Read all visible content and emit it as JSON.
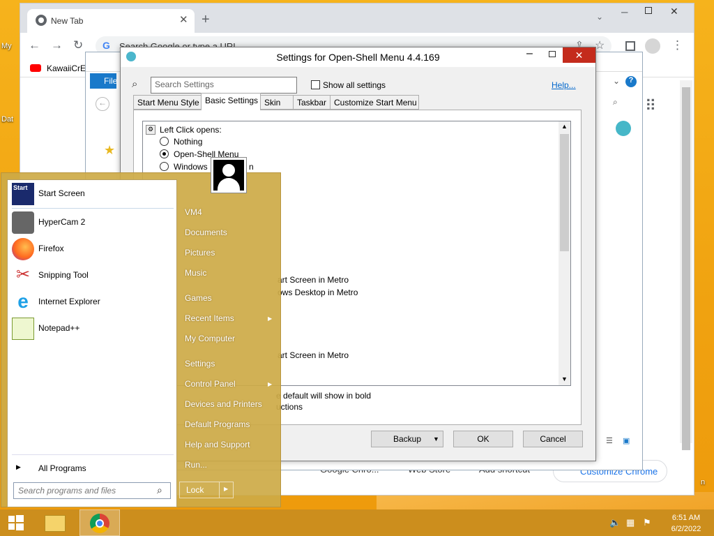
{
  "desktop": {
    "labels": [
      "My",
      "Dat",
      "n"
    ]
  },
  "chrome": {
    "tab_title": "New Tab",
    "omnibox_placeholder": "Search Google or type a URL",
    "bookmark": "KawaiiCrE's",
    "customize_button": "Customize Chrome",
    "shortcuts": [
      "Google Chro...",
      "Web Store",
      "Add shortcut"
    ]
  },
  "explorer": {
    "file_tab": "File"
  },
  "dialog": {
    "title": "Settings for Open-Shell Menu 4.4.169",
    "search_placeholder": "Search Settings",
    "show_all_label": "Show all settings",
    "help_link": "Help...",
    "tabs": [
      "Start Menu Style",
      "Basic Settings",
      "Skin",
      "Taskbar",
      "Customize Start Menu"
    ],
    "tree": {
      "group_label": "Left Click opens:",
      "options": [
        "Nothing",
        "Open-Shell Menu",
        "Windows"
      ],
      "partial_suffix": "n",
      "visible_lines": [
        "art Screen in Metro",
        "ows Desktop in Metro",
        "art Screen in Metro"
      ]
    },
    "footer_lines": [
      "e default will show in bold",
      "uctions"
    ],
    "buttons": {
      "backup": "Backup",
      "ok": "OK",
      "cancel": "Cancel"
    }
  },
  "start_menu": {
    "pinned": [
      {
        "label": "Start Screen",
        "icon": "start-screen-icon"
      },
      {
        "label": "HyperCam 2",
        "icon": "hypercam-icon"
      },
      {
        "label": "Firefox",
        "icon": "firefox-icon"
      },
      {
        "label": "Snipping Tool",
        "icon": "snipping-tool-icon"
      },
      {
        "label": "Internet Explorer",
        "icon": "internet-explorer-icon"
      },
      {
        "label": "Notepad++",
        "icon": "notepadpp-icon"
      }
    ],
    "start_screen_badge": "Start",
    "all_programs": "All Programs",
    "search_placeholder": "Search programs and files",
    "right_items": [
      "VM4",
      "Documents",
      "Pictures",
      "Music",
      "Games",
      "Recent Items",
      "My Computer",
      "Settings",
      "Control Panel",
      "Devices and Printers",
      "Default Programs",
      "Help and Support",
      "Run..."
    ],
    "lock_label": "Lock"
  },
  "taskbar": {
    "time": "6:51 AM",
    "date": "6/2/2022"
  }
}
